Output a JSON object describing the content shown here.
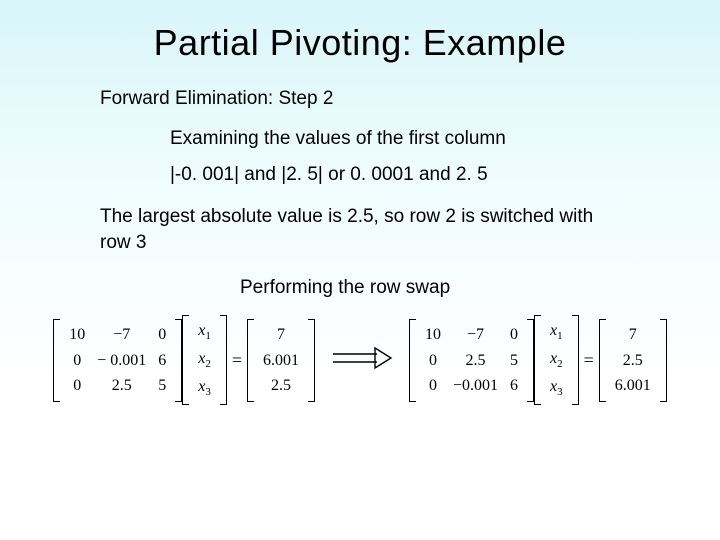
{
  "title": "Partial Pivoting: Example",
  "subtitle": "Forward Elimination: Step 2",
  "line_examining": "Examining the values of the first column",
  "line_values": "|-0. 001| and |2. 5| or 0. 0001 and 2. 5",
  "line_largest": "The largest absolute value is 2.5, so row 2 is switched with row 3",
  "line_performing": "Performing the row swap",
  "eq_symbol": "=",
  "matrix_before": {
    "A": [
      [
        "10",
        "−7",
        "0"
      ],
      [
        "0",
        "− 0.001",
        "6"
      ],
      [
        "0",
        "2.5",
        "5"
      ]
    ],
    "x": [
      "x1",
      "x2",
      "x3"
    ],
    "b": [
      "7",
      "6.001",
      "2.5"
    ]
  },
  "matrix_after": {
    "A": [
      [
        "10",
        "−7",
        "0"
      ],
      [
        "0",
        "2.5",
        "5"
      ],
      [
        "0",
        "−0.001",
        "6"
      ]
    ],
    "x": [
      "x1",
      "x2",
      "x3"
    ],
    "b": [
      "7",
      "2.5",
      "6.001"
    ]
  }
}
